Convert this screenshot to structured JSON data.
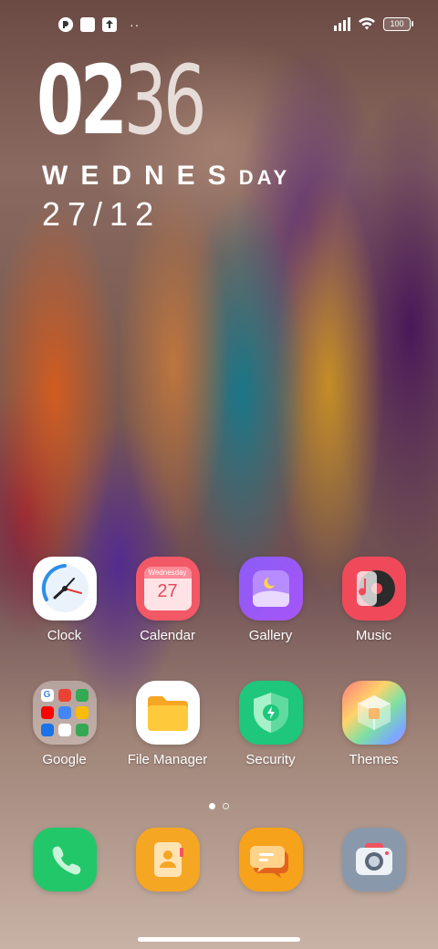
{
  "status_bar": {
    "battery": "100",
    "icons": [
      "circle-app-icon",
      "square-notification-icon",
      "upload-icon",
      "more-dots-icon",
      "signal-icon",
      "wifi-icon",
      "battery-icon"
    ],
    "dots": "··"
  },
  "clock": {
    "hours": "02",
    "minutes": "36",
    "weekday_big": "WEDNES",
    "weekday_small": "DAY",
    "date": "27/12"
  },
  "apps": [
    {
      "label": "Clock",
      "icon": "clock-icon"
    },
    {
      "label": "Calendar",
      "icon": "calendar-icon",
      "badge_month": "Wednesday",
      "badge_day": "27"
    },
    {
      "label": "Gallery",
      "icon": "gallery-icon"
    },
    {
      "label": "Music",
      "icon": "music-icon"
    },
    {
      "label": "Google",
      "icon": "google-folder-icon"
    },
    {
      "label": "File Manager",
      "icon": "folder-icon"
    },
    {
      "label": "Security",
      "icon": "shield-icon"
    },
    {
      "label": "Themes",
      "icon": "themes-cube-icon"
    }
  ],
  "dock": [
    {
      "icon": "phone-icon",
      "color": "#22c76a"
    },
    {
      "icon": "contacts-icon",
      "color": "#f5a623"
    },
    {
      "icon": "messages-icon",
      "color": "#f7a21b"
    },
    {
      "icon": "camera-icon",
      "color": "#8a98ab"
    }
  ],
  "page_indicator": {
    "pages": 2,
    "current": 1
  }
}
